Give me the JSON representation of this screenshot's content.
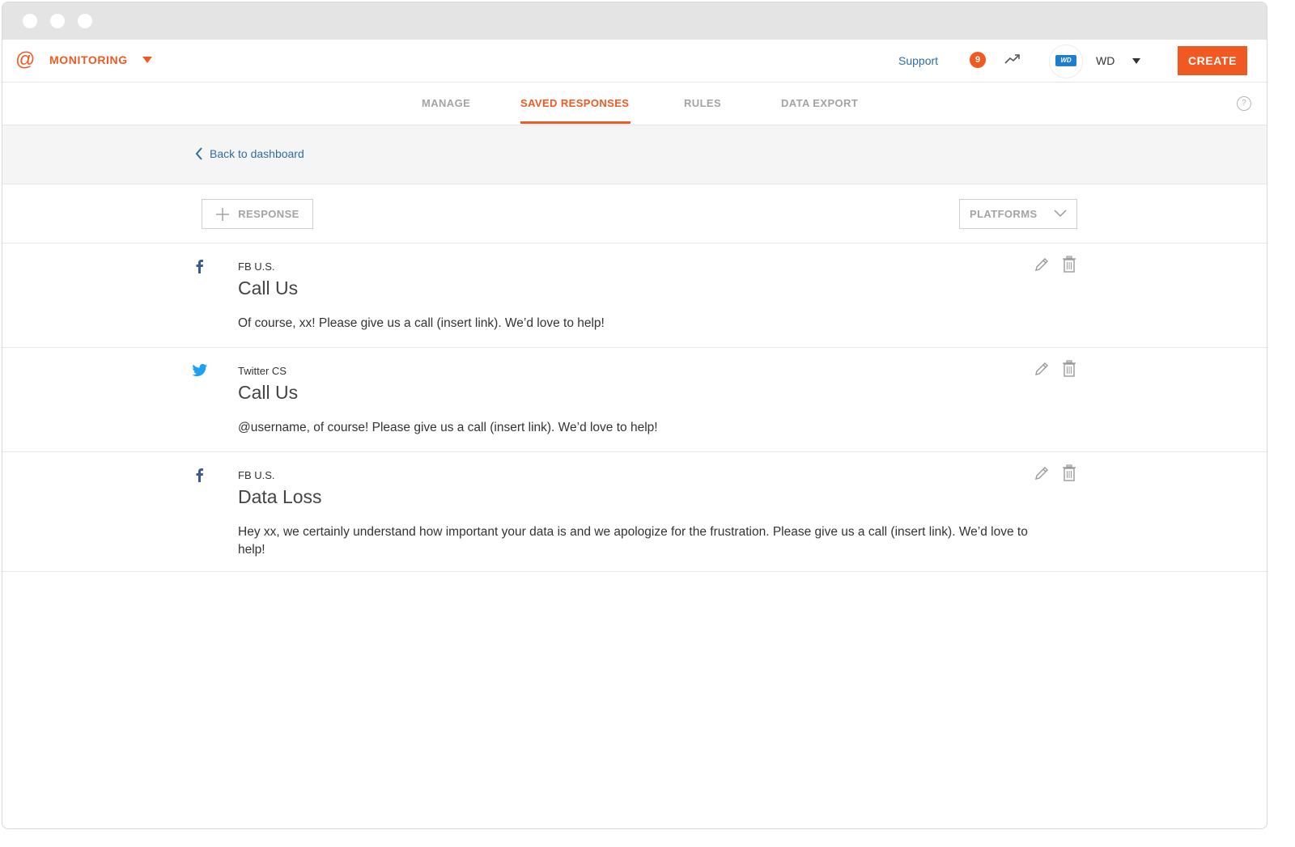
{
  "app": {
    "brand_label": "MONITORING"
  },
  "header": {
    "support_label": "Support",
    "notification_count": "9",
    "avatar_logo_text": "WD",
    "user_initials": "WD",
    "create_label": "CREATE"
  },
  "tabs": [
    {
      "label": "MANAGE",
      "active": false
    },
    {
      "label": "SAVED RESPONSES",
      "active": true
    },
    {
      "label": "RULES",
      "active": false
    },
    {
      "label": "DATA EXPORT",
      "active": false
    }
  ],
  "help_label": "?",
  "back_link_label": "Back to dashboard",
  "toolbar": {
    "add_response_label": "RESPONSE",
    "platforms_label": "PLATFORMS"
  },
  "responses": [
    {
      "platform_icon": "facebook-icon",
      "account": "FB U.S.",
      "title": "Call Us",
      "body": "Of course, xx! Please give us a call (insert link). We’d love to help!"
    },
    {
      "platform_icon": "twitter-icon",
      "account": "Twitter CS",
      "title": "Call Us",
      "body": "@username, of course! Please give us a call (insert link). We’d love to help!"
    },
    {
      "platform_icon": "facebook-icon",
      "account": "FB U.S.",
      "title": "Data Loss",
      "body": "Hey xx, we certainly understand how important your data is and we apologize for the frustration. Please give us a call (insert link). We’d love to help!"
    }
  ],
  "colors": {
    "accent": "#f05a22",
    "link": "#2f6da3",
    "facebook": "#3b5998",
    "twitter": "#1da1f2"
  }
}
